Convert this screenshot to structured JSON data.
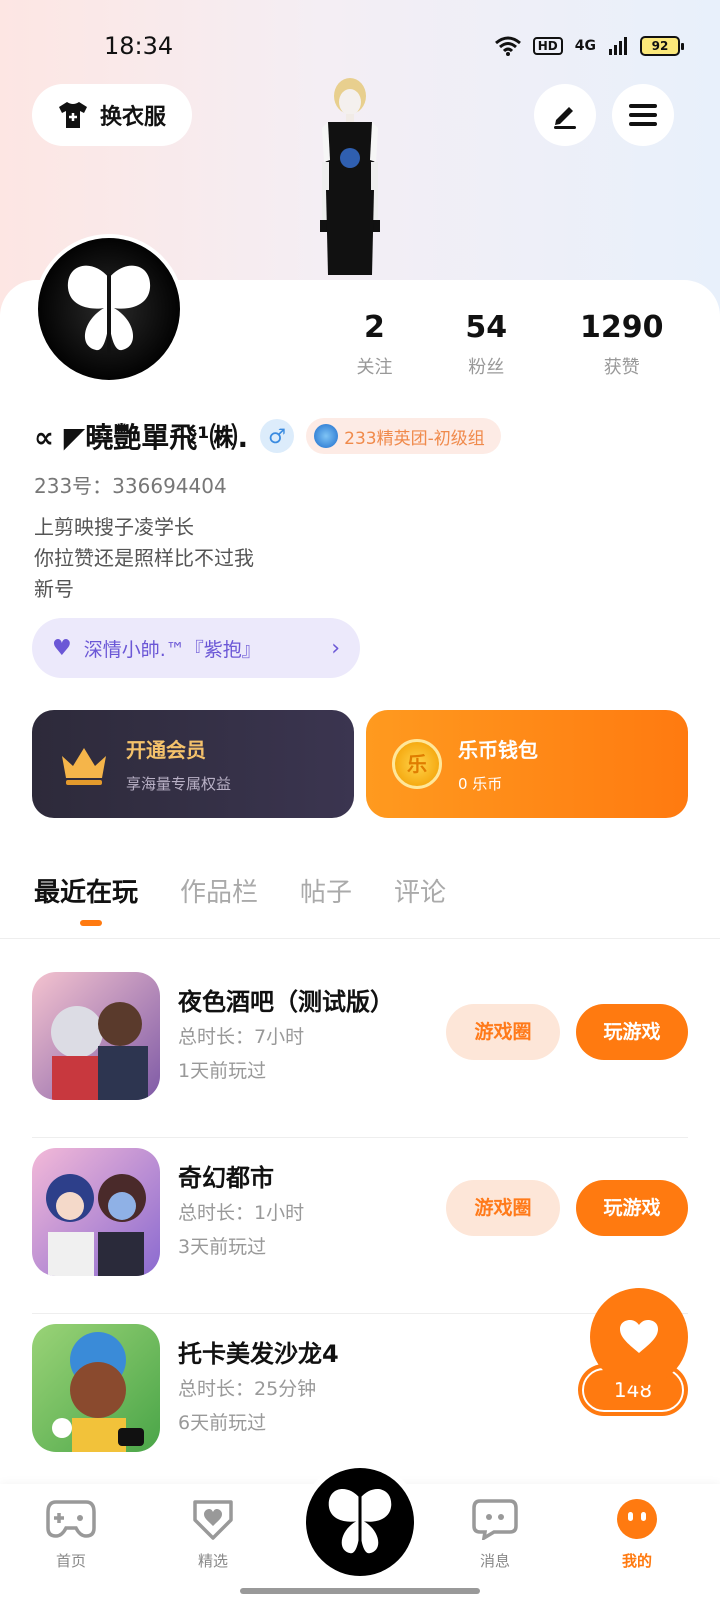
{
  "status": {
    "time": "18:34",
    "hd": "HD",
    "network": "4G",
    "battery": "92"
  },
  "header": {
    "outfit_label": "换衣服",
    "edit_icon": "pen-icon",
    "menu_icon": "menu-icon"
  },
  "profile": {
    "name": "∝ ◤曉艷單飛¹㈱.",
    "gender_symbol": "♂",
    "badge": "233精英团-初级组",
    "uid": "233号：336694404",
    "bio_lines": [
      "上剪映搜子凌学长",
      "你拉赞还是照样比不过我",
      "新号"
    ],
    "stats": [
      {
        "value": "2",
        "label": "关注"
      },
      {
        "value": "54",
        "label": "粉丝"
      },
      {
        "value": "1290",
        "label": "获赞"
      }
    ],
    "intimacy": "深情小帥.™『紫抱』"
  },
  "promos": {
    "vip": {
      "title": "开通会员",
      "subtitle": "享海量专属权益"
    },
    "wallet": {
      "title": "乐币钱包",
      "subtitle": "0 乐币",
      "coin_char": "乐"
    }
  },
  "tabs": [
    "最近在玩",
    "作品栏",
    "帖子",
    "评论"
  ],
  "games": [
    {
      "title": "夜色酒吧（测试版）",
      "duration": "总时长：7小时",
      "last": "1天前玩过",
      "circle_btn": "游戏圈",
      "play_btn": "玩游戏",
      "bg": "#e9a9b8"
    },
    {
      "title": "奇幻都市",
      "duration": "总时长：1小时",
      "last": "3天前玩过",
      "circle_btn": "游戏圈",
      "play_btn": "玩游戏",
      "bg": "#c9b4e8"
    },
    {
      "title": "托卡美发沙龙4",
      "duration": "总时长：25分钟",
      "last": "6天前玩过",
      "circle_btn": "",
      "play_btn": "",
      "bg": "#7fc27a"
    }
  ],
  "like": {
    "count": "148"
  },
  "nav": [
    {
      "label": "首页",
      "icon": "gamepad-icon"
    },
    {
      "label": "精选",
      "icon": "heart-tag-icon"
    },
    {
      "label": "消息",
      "icon": "chat-icon"
    },
    {
      "label": "我的",
      "icon": "face-icon"
    }
  ],
  "colors": {
    "accent": "#ff7a10",
    "vip_bg": "#2d2a3a",
    "intimacy": "#6b57d6"
  }
}
